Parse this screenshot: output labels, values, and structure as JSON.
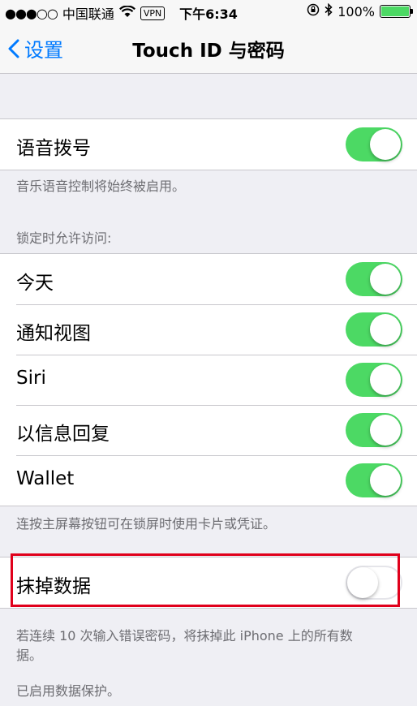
{
  "status_bar": {
    "signal": "●●●○○",
    "carrier": "中国联通",
    "vpn": "VPN",
    "time": "下午6:34",
    "battery_percent": "100%"
  },
  "nav": {
    "back_label": "设置",
    "title": "Touch ID 与密码"
  },
  "voice_dial": {
    "label": "语音拨号",
    "on": true,
    "footer": "音乐语音控制将始终被启用。"
  },
  "lock_access": {
    "header": "锁定时允许访问:",
    "items": [
      {
        "label": "今天",
        "on": true
      },
      {
        "label": "通知视图",
        "on": true
      },
      {
        "label": "Siri",
        "on": true
      },
      {
        "label": "以信息回复",
        "on": true
      },
      {
        "label": "Wallet",
        "on": true
      }
    ],
    "footer": "连按主屏幕按钮可在锁屏时使用卡片或凭证。"
  },
  "erase_data": {
    "label": "抹掉数据",
    "on": false,
    "footer_line1": "若连续 10 次输入错误密码，将抹掉此 iPhone 上的所有数",
    "footer_line2": "据。",
    "status": "已启用数据保护。"
  },
  "colors": {
    "accent": "#007aff",
    "toggle_on": "#4cd964",
    "highlight": "#e0001b"
  }
}
